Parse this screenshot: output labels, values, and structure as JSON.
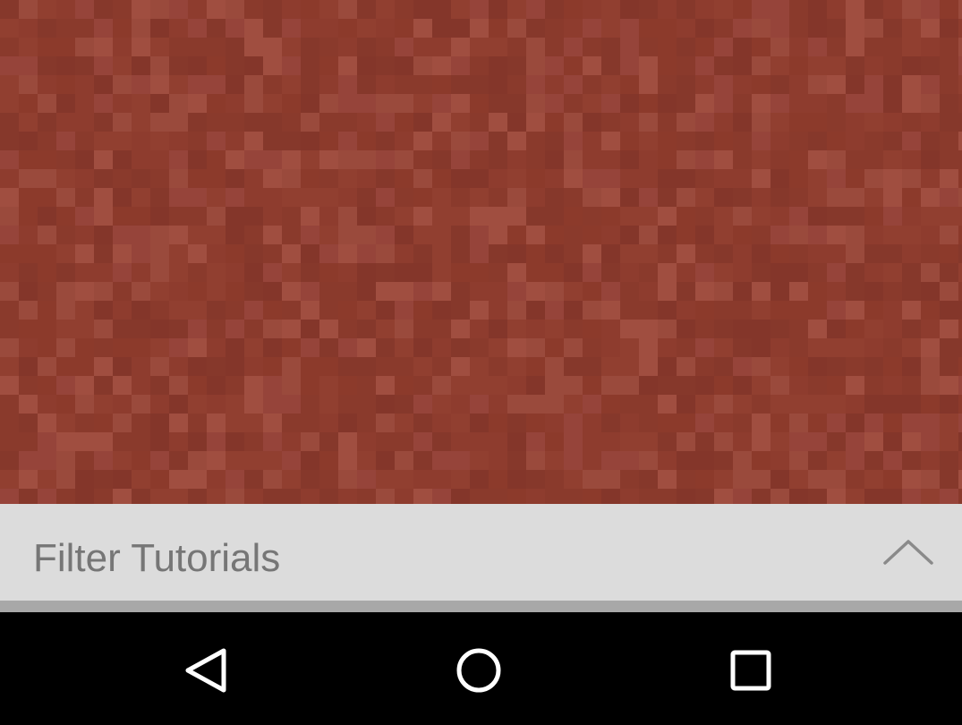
{
  "background": {
    "base_color": "#8e3c2e",
    "texture": "red-brick-pixel-texture"
  },
  "filter_bar": {
    "label": "Filter Tutorials",
    "expand_icon": "chevron-up-icon",
    "background_color": "#dcdcdc",
    "text_color": "#767676"
  },
  "nav_bar": {
    "back_icon": "back-triangle-icon",
    "home_icon": "home-circle-icon",
    "recents_icon": "recents-square-icon"
  }
}
